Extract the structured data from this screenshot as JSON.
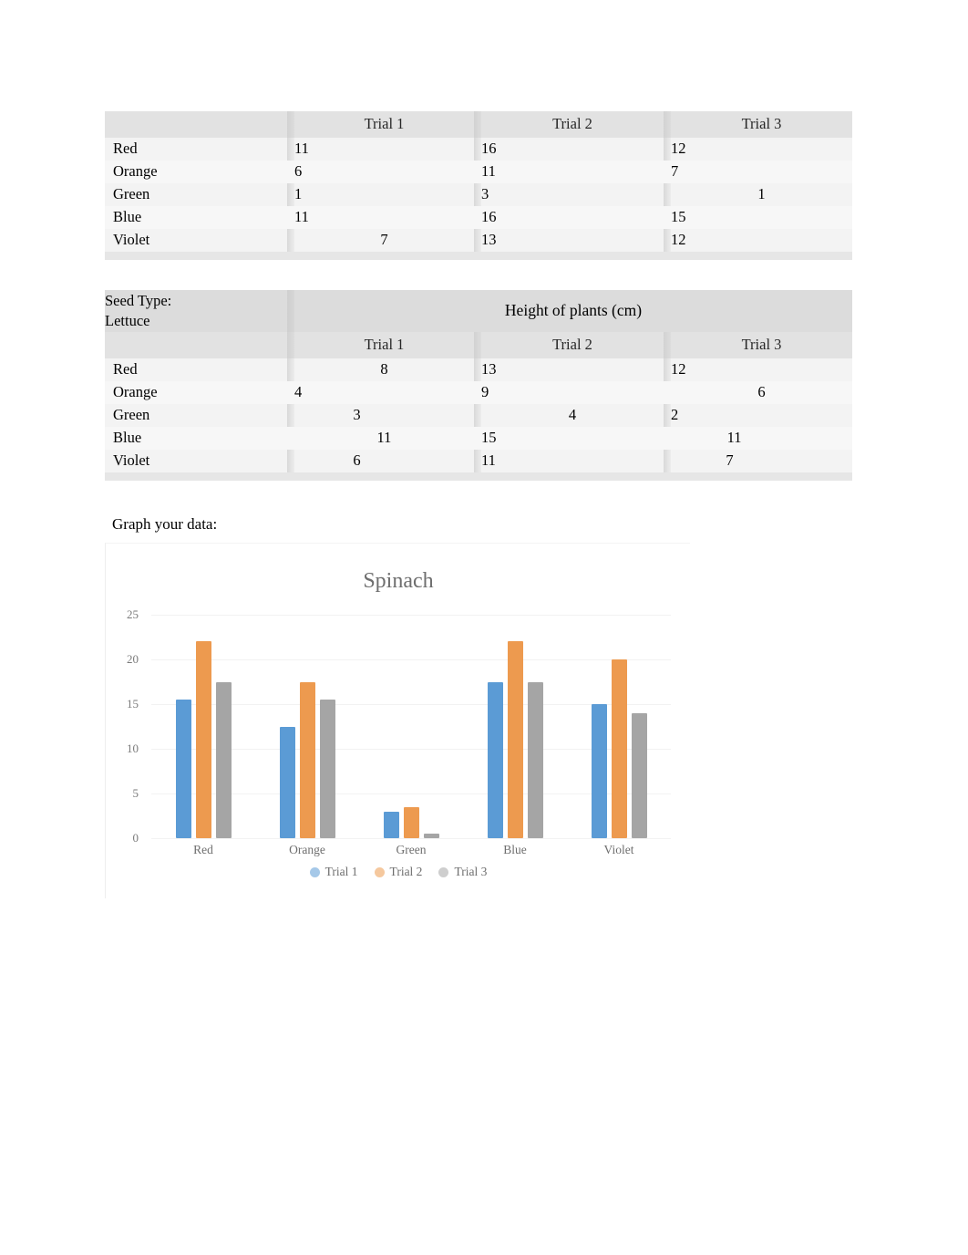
{
  "document": {
    "prompt_label": "Graph your data:"
  },
  "table_spinach": {
    "headers": [
      "",
      "Trial 1",
      "Trial 2",
      "Trial 3"
    ],
    "rows": [
      {
        "label": "Red",
        "t1": "11",
        "t2": "16",
        "t3": "12"
      },
      {
        "label": "Orange",
        "t1": "6",
        "t2": "11",
        "t3": "7"
      },
      {
        "label": "Green",
        "t1": "1",
        "t2": "3",
        "t3": "1"
      },
      {
        "label": "Blue",
        "t1": "11",
        "t2": "16",
        "t3": "15"
      },
      {
        "label": "Violet",
        "t1": "7",
        "t2": "13",
        "t3": "12"
      }
    ]
  },
  "table_lettuce": {
    "seed_type_label": "Seed Type:",
    "seed_type_value": "Lettuce",
    "measure_header": "Height of plants (cm)",
    "headers": [
      "",
      "Trial 1",
      "Trial 2",
      "Trial 3"
    ],
    "rows": [
      {
        "label": "Red",
        "t1": "8",
        "t2": "13",
        "t3": "12"
      },
      {
        "label": "Orange",
        "t1": "4",
        "t2": "9",
        "t3": "6"
      },
      {
        "label": "Green",
        "t1": "3",
        "t2": "4",
        "t3": "2"
      },
      {
        "label": "Blue",
        "t1": "11",
        "t2": "15",
        "t3": "11"
      },
      {
        "label": "Violet",
        "t1": "6",
        "t2": "11",
        "t3": "7"
      }
    ]
  },
  "chart_data": {
    "type": "bar",
    "title": "Spinach",
    "xlabel": "",
    "ylabel": "",
    "ylim": [
      0,
      25
    ],
    "yticks": [
      "25",
      "20",
      "15",
      "10",
      "5",
      "0"
    ],
    "grid": true,
    "legend_position": "bottom",
    "categories": [
      "Red",
      "Orange",
      "Green",
      "Blue",
      "Violet"
    ],
    "series": [
      {
        "name": "Trial 1",
        "color": "#5B9BD5",
        "values": [
          15.5,
          12.5,
          3,
          17.5,
          15
        ]
      },
      {
        "name": "Trial 2",
        "color": "#ED9A4F",
        "values": [
          22,
          17.5,
          3.5,
          22,
          20
        ]
      },
      {
        "name": "Trial 3",
        "color": "#A5A5A5",
        "values": [
          17.5,
          15.5,
          0.5,
          17.5,
          14
        ]
      }
    ]
  }
}
